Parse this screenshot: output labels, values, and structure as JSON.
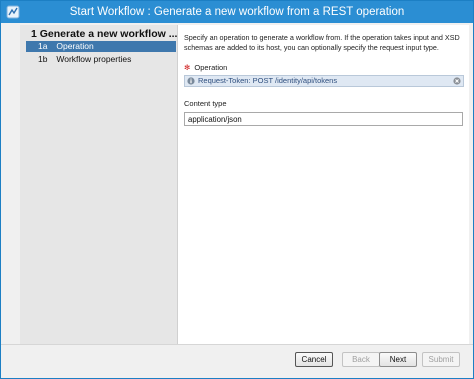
{
  "window": {
    "title": "Start Workflow : Generate a new workflow from a REST operation"
  },
  "sidebar": {
    "step_title": "1  Generate a new workflow ...",
    "items": [
      {
        "num": "1a",
        "label": "Operation",
        "selected": true
      },
      {
        "num": "1b",
        "label": "Workflow properties",
        "selected": false
      }
    ]
  },
  "main": {
    "description": "Specify an operation to generate a workflow from. If the operation takes input and XSD schemas are added to its host, you can optionally specify the request input type.",
    "operation": {
      "required_marker": "✻",
      "label": "Operation",
      "value": "Request-Token: POST /identity/api/tokens"
    },
    "content_type": {
      "label": "Content type",
      "value": "application/json"
    }
  },
  "footer": {
    "cancel": "Cancel",
    "back": "Back",
    "next": "Next",
    "submit": "Submit"
  },
  "colors": {
    "title_bar": "#2b8ed3",
    "selection": "#3f78ad",
    "operation_field": "#dfe8f3"
  }
}
